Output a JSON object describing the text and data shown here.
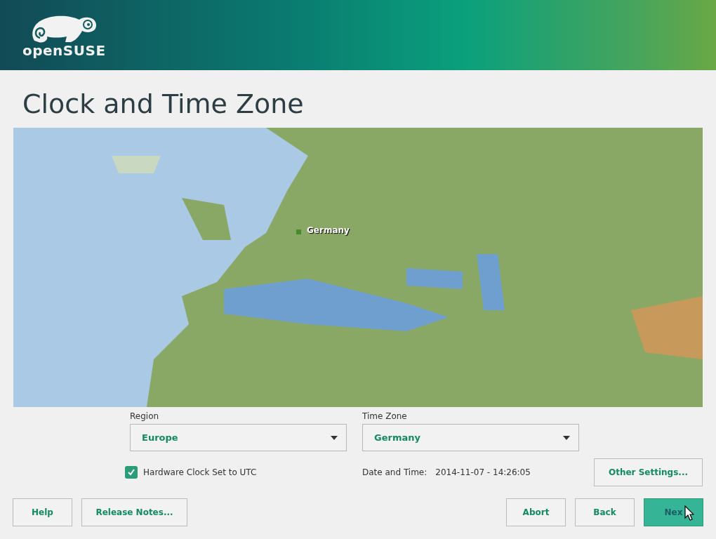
{
  "header": {
    "logo_text": "openSUSE"
  },
  "title": "Clock and Time Zone",
  "map": {
    "marker_label": "Germany"
  },
  "region": {
    "label": "Region",
    "value": "Europe"
  },
  "time_zone": {
    "label": "Time Zone",
    "value": "Germany"
  },
  "hardware_clock": {
    "label": "Hardware Clock Set to UTC",
    "checked": true
  },
  "date_time": {
    "label": "Date and Time:",
    "value": "2014-11-07 - 14:26:05"
  },
  "other_settings_button": "Other Settings...",
  "buttons_left": [
    {
      "label": "Help",
      "selected": false
    },
    {
      "label": "Release Notes...",
      "selected": false
    }
  ],
  "buttons_right": [
    {
      "label": "Abort",
      "selected": false
    },
    {
      "label": "Back",
      "selected": false
    },
    {
      "label": "Nex",
      "selected": true
    }
  ]
}
